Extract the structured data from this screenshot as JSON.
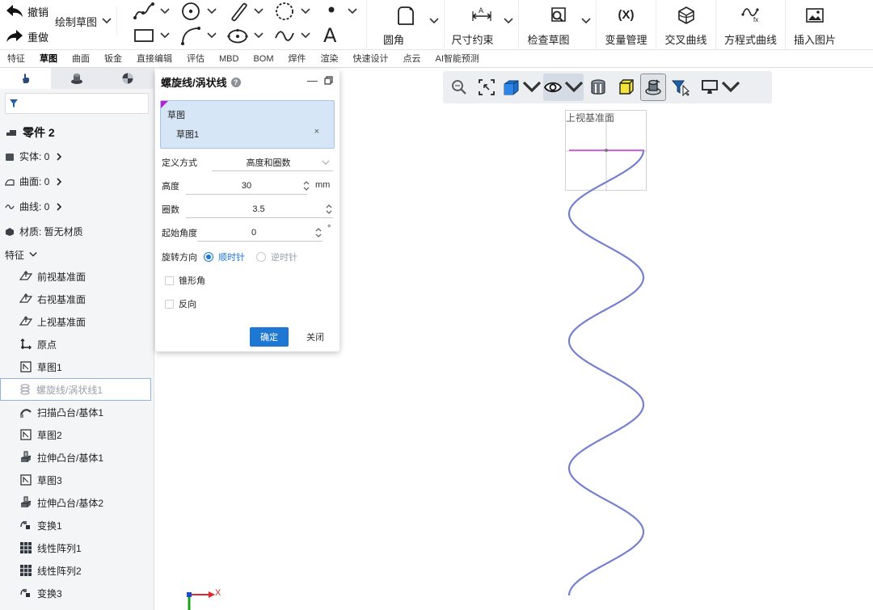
{
  "ribbon": {
    "undo_label": "撤销",
    "redo_label": "重做",
    "draw_sketch_label": "绘制草图",
    "text_tool_glyph": "A",
    "fillet_label": "圆角",
    "dimension_label": "尺寸约束",
    "check_sketch_label": "检查草图",
    "variables_label": "变量管理",
    "variables_glyph": "(X)",
    "intersect_curve_label": "交叉曲线",
    "equation_curve_label": "方程式曲线",
    "equation_curve_glyph": "fx",
    "insert_image_label": "插入图片"
  },
  "tabs": [
    {
      "label": "特征"
    },
    {
      "label": "草图"
    },
    {
      "label": "曲面"
    },
    {
      "label": "钣金"
    },
    {
      "label": "直接编辑"
    },
    {
      "label": "评估"
    },
    {
      "label": "MBD"
    },
    {
      "label": "BOM"
    },
    {
      "label": "焊件"
    },
    {
      "label": "渲染"
    },
    {
      "label": "快速设计"
    },
    {
      "label": "点云"
    },
    {
      "label": "AI智能预测"
    }
  ],
  "active_tab": "草图",
  "left_panel": {
    "part_name": "零件 2",
    "solid_label": "实体: 0",
    "surface_label": "曲面: 0",
    "curve_label": "曲线: 0",
    "material_label": "材质: 暂无材质",
    "features_header": "特征",
    "tree": [
      {
        "label": "前视基准面",
        "icon": "plane-icon"
      },
      {
        "label": "右视基准面",
        "icon": "plane-icon"
      },
      {
        "label": "上视基准面",
        "icon": "plane-icon"
      },
      {
        "label": "原点",
        "icon": "origin-icon"
      },
      {
        "label": "草图1",
        "icon": "sketch-icon"
      },
      {
        "label": "螺旋线/涡状线1",
        "icon": "helix-icon"
      },
      {
        "label": "扫描凸台/基体1",
        "icon": "sweep-icon"
      },
      {
        "label": "草图2",
        "icon": "sketch-icon"
      },
      {
        "label": "拉伸凸台/基体1",
        "icon": "extrude-icon"
      },
      {
        "label": "草图3",
        "icon": "sketch-icon"
      },
      {
        "label": "拉伸凸台/基体2",
        "icon": "extrude-icon"
      },
      {
        "label": "变换1",
        "icon": "transform-icon"
      },
      {
        "label": "线性阵列1",
        "icon": "pattern-icon"
      },
      {
        "label": "线性阵列2",
        "icon": "pattern-icon"
      },
      {
        "label": "变换3",
        "icon": "transform-icon"
      }
    ]
  },
  "dialog": {
    "title": "螺旋线/涡状线",
    "sketch_section_label": "草图",
    "sketch_value": "草图1",
    "remove_glyph": "×",
    "definition_label": "定义方式",
    "definition_value": "高度和圈数",
    "height_label": "高度",
    "height_value": "30",
    "height_unit": "mm",
    "turns_label": "圈数",
    "turns_value": "3.5",
    "start_angle_label": "起始角度",
    "start_angle_value": "0",
    "start_angle_unit": "°",
    "direction_label": "旋转方向",
    "clockwise_label": "顺时针",
    "counterclockwise_label": "逆时针",
    "direction_selected": "clockwise",
    "taper_label": "锥形角",
    "taper_checked": false,
    "reverse_label": "反向",
    "reverse_checked": false,
    "ok_label": "确定",
    "close_label": "关闭",
    "minimize_glyph": "—"
  },
  "viewport": {
    "plane_label": "上视基准面",
    "axis_x_label": "X",
    "helix_color": "#7580d0",
    "sketch_line_color": "#c83ce0"
  },
  "colors": {
    "accent": "#1f77d4",
    "selection_bg": "#d7e6f7"
  }
}
